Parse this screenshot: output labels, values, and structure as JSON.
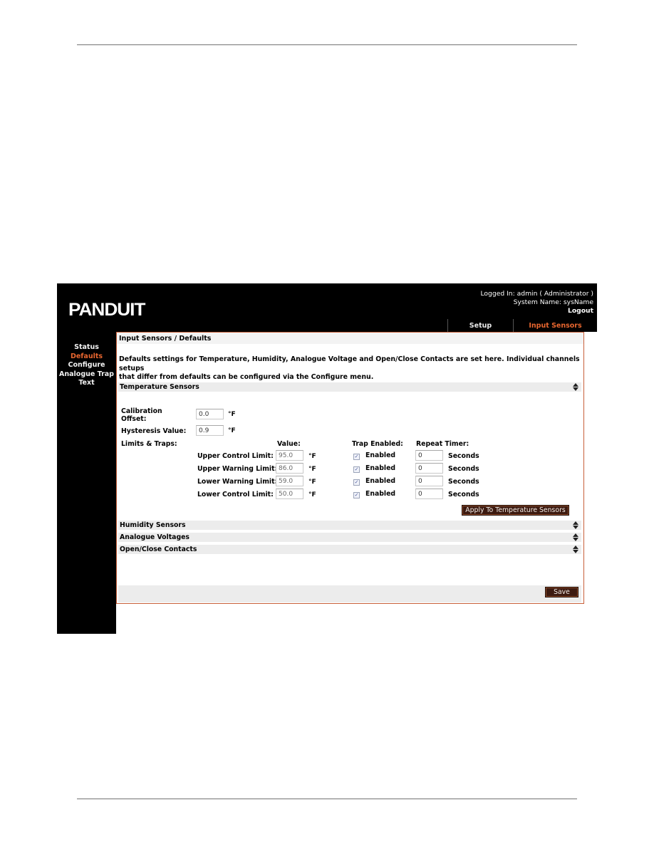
{
  "header": {
    "logo_text": "PANDUIT",
    "logged_in": "Logged In: admin ( Administrator )",
    "system_name": "System Name: sysName",
    "logout_label": "Logout",
    "tabs": [
      {
        "label": "Setup",
        "active": false
      },
      {
        "label": "Input Sensors",
        "active": true
      }
    ]
  },
  "sidebar": {
    "items": [
      {
        "label": "Status",
        "active": false
      },
      {
        "label": "Defaults",
        "active": true
      },
      {
        "label": "Configure",
        "active": false
      },
      {
        "label": "Analogue Trap",
        "active": false
      },
      {
        "label": "Text",
        "active": false
      }
    ]
  },
  "panel": {
    "title": "Input Sensors / Defaults",
    "intro_line1": "Defaults settings for Temperature, Humidity, Analogue Voltage and Open/Close Contacts are set here. Individual channels setups",
    "intro_line2": "that differ from defaults can be configured via the Configure menu.",
    "temperature": {
      "section_label": "Temperature Sensors",
      "calibration_label_1": "Calibration",
      "calibration_label_2": "Offset:",
      "calibration_value": "0.0",
      "hysteresis_label": "Hysteresis Value:",
      "hysteresis_value": "0.9",
      "unit": "°F",
      "limits_label": "Limits & Traps:",
      "col_value": "Value:",
      "col_trap": "Trap Enabled:",
      "col_timer": "Repeat Timer:",
      "rows": [
        {
          "label": "Upper Control Limit:",
          "value": "95.0",
          "unit": "°F",
          "trap_label": "Enabled",
          "trap_checked": true,
          "timer": "0",
          "timer_unit": "Seconds"
        },
        {
          "label": "Upper Warning Limit:",
          "value": "86.0",
          "unit": "°F",
          "trap_label": "Enabled",
          "trap_checked": true,
          "timer": "0",
          "timer_unit": "Seconds"
        },
        {
          "label": "Lower Warning Limit:",
          "value": "59.0",
          "unit": "°F",
          "trap_label": "Enabled",
          "trap_checked": true,
          "timer": "0",
          "timer_unit": "Seconds"
        },
        {
          "label": "Lower Control Limit:",
          "value": "50.0",
          "unit": "°F",
          "trap_label": "Enabled",
          "trap_checked": true,
          "timer": "0",
          "timer_unit": "Seconds"
        }
      ],
      "apply_button": "Apply To Temperature Sensors"
    },
    "sections": [
      {
        "label": "Humidity Sensors"
      },
      {
        "label": "Analogue Voltages"
      },
      {
        "label": "Open/Close Contacts"
      }
    ],
    "save_button": "Save"
  },
  "colors": {
    "accent": "#e8662f",
    "panel_border": "#c8603a",
    "button_bg": "#3c1a10",
    "header_bg": "#000000"
  }
}
